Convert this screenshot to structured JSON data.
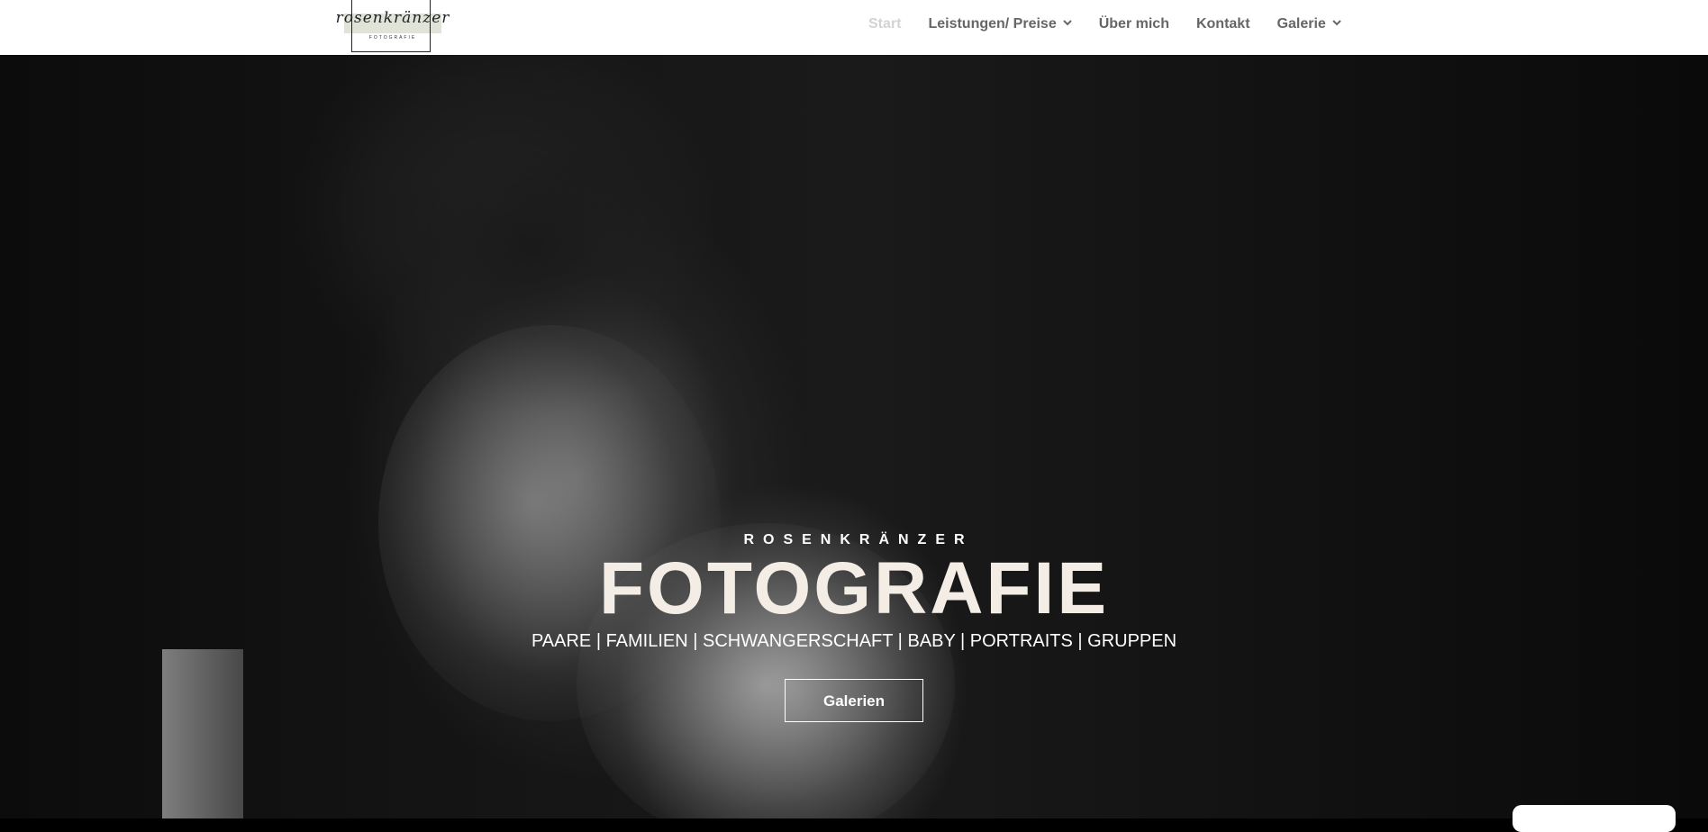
{
  "header": {
    "logo": {
      "script_text": "rosenkränzer",
      "sub_text": "FOTOGRAFIE"
    },
    "nav": [
      {
        "label": "Start",
        "active": true,
        "has_dropdown": false
      },
      {
        "label": "Leistungen/ Preise",
        "active": false,
        "has_dropdown": true
      },
      {
        "label": "Über mich",
        "active": false,
        "has_dropdown": false
      },
      {
        "label": "Kontakt",
        "active": false,
        "has_dropdown": false
      },
      {
        "label": "Galerie",
        "active": false,
        "has_dropdown": true
      }
    ],
    "dropdown_icon": "chevron-down-icon"
  },
  "hero": {
    "eyebrow": "ROSENKRÄNZER",
    "headline": "FOTOGRAFIE",
    "subline": "PAARE | FAMILIEN | SCHWANGERSCHAFT | BABY | PORTRAITS | GRUPPEN",
    "button_label": "Galerien"
  },
  "colors": {
    "nav_text": "#666666",
    "nav_active": "#d3d3d3",
    "headline": "#f3ede6",
    "header_bg": "#ffffff"
  }
}
